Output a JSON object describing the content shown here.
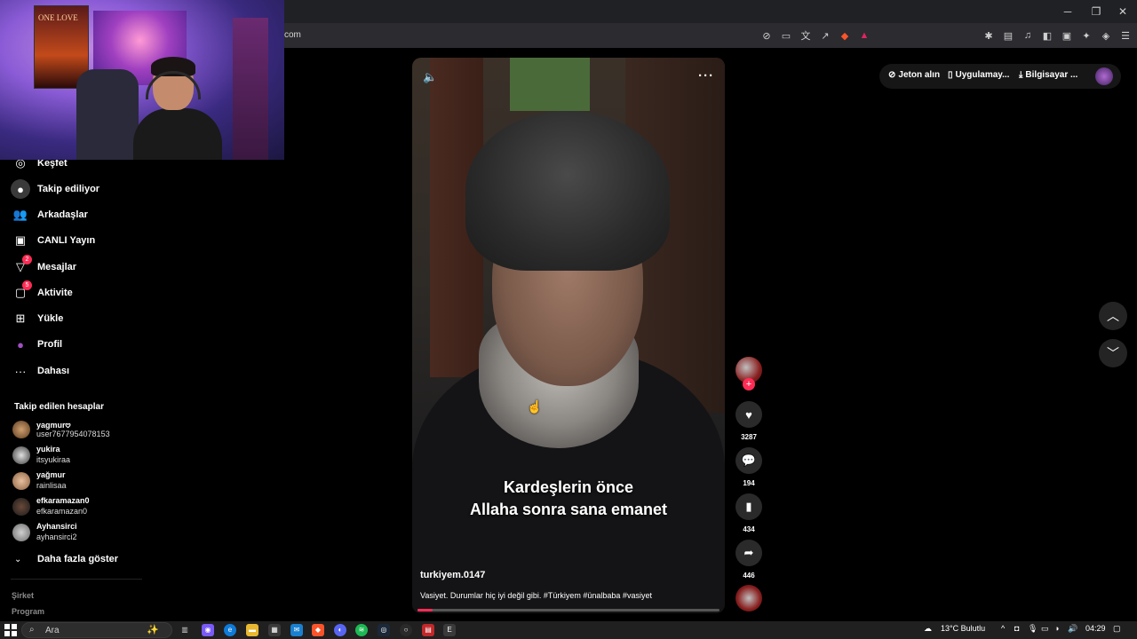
{
  "browser": {
    "url": "com",
    "window_controls": {
      "minimize": "─",
      "restore": "❐",
      "close": "✕"
    }
  },
  "sidebar": {
    "items": [
      {
        "label": "Keşfet",
        "icon": "◎"
      },
      {
        "label": "Takip ediliyor",
        "icon": "●"
      },
      {
        "label": "Arkadaşlar",
        "icon": "👥"
      },
      {
        "label": "CANLI Yayın",
        "icon": "▣"
      },
      {
        "label": "Mesajlar",
        "icon": "▽",
        "badge": "2"
      },
      {
        "label": "Aktivite",
        "icon": "▢",
        "badge": "5"
      },
      {
        "label": "Yükle",
        "icon": "⊞"
      },
      {
        "label": "Profil",
        "icon": "●"
      },
      {
        "label": "Dahası",
        "icon": "···"
      }
    ],
    "following_header": "Takip edilen hesaplar",
    "accounts": [
      {
        "name": "yagmur𖹭",
        "handle": "user7677954078153"
      },
      {
        "name": "yukira",
        "handle": "itsyukiraa"
      },
      {
        "name": "yağmur",
        "handle": "rainlisaa"
      },
      {
        "name": "efkaramazan0",
        "handle": "efkaramazan0"
      },
      {
        "name": "Ayhansirci",
        "handle": "ayhansirci2"
      }
    ],
    "more_label": "Daha fazla göster",
    "footer": [
      "Şirket",
      "Program"
    ]
  },
  "header": {
    "coins": "Jeton alın",
    "app": "Uygulamay...",
    "desktop": "Bilgisayar ..."
  },
  "video": {
    "caption_line1": "Kardeşlerin önce",
    "caption_line2": "Allaha sonra sana emanet",
    "username": "turkiyem.0147",
    "description": "Vasiyet. Durumlar hiç iyi değil gibi. #Türkiyem #ünalbaba #vasiyet",
    "progress": 0.05
  },
  "actions": {
    "likes": "3287",
    "comments": "194",
    "saves": "434",
    "shares": "446"
  },
  "webcam": {
    "poster_text": "ONE LOVE"
  },
  "taskbar": {
    "search_placeholder": "Ara",
    "weather": "13°C  Bulutlu",
    "time": "04:29"
  }
}
